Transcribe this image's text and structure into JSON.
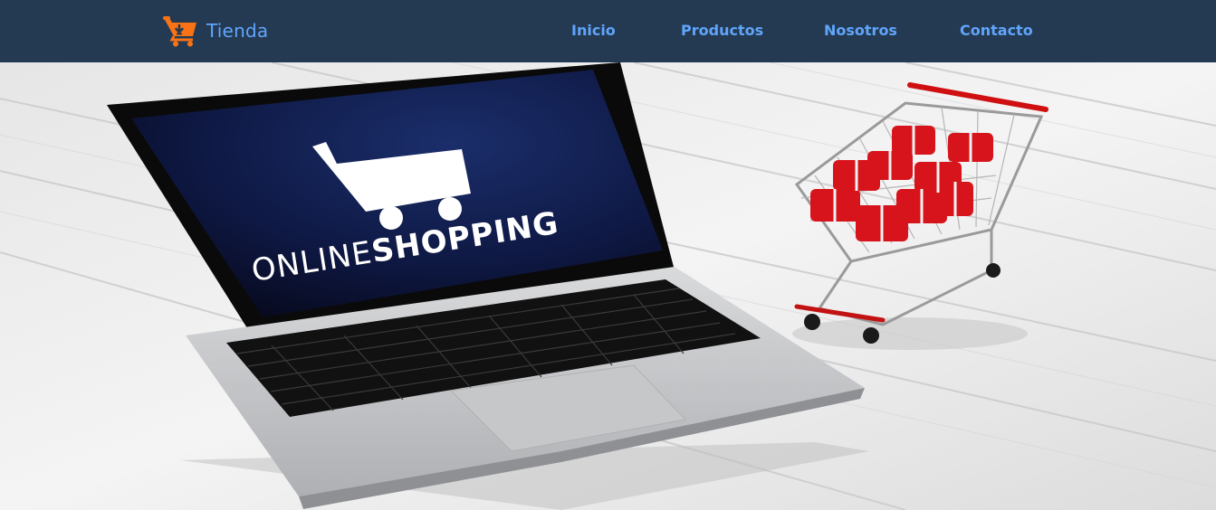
{
  "brand": {
    "name": "Tienda",
    "icon": "shopping-cart-icon"
  },
  "nav": {
    "links": [
      {
        "label": "Inicio"
      },
      {
        "label": "Productos"
      },
      {
        "label": "Nosotros"
      },
      {
        "label": "Contacto"
      }
    ]
  },
  "hero": {
    "screen_text_light": "ONLINE",
    "screen_text_bold": "SHOPPING"
  },
  "colors": {
    "navbar": "#243a53",
    "link": "#60a5fa",
    "logo": "#f97316"
  }
}
